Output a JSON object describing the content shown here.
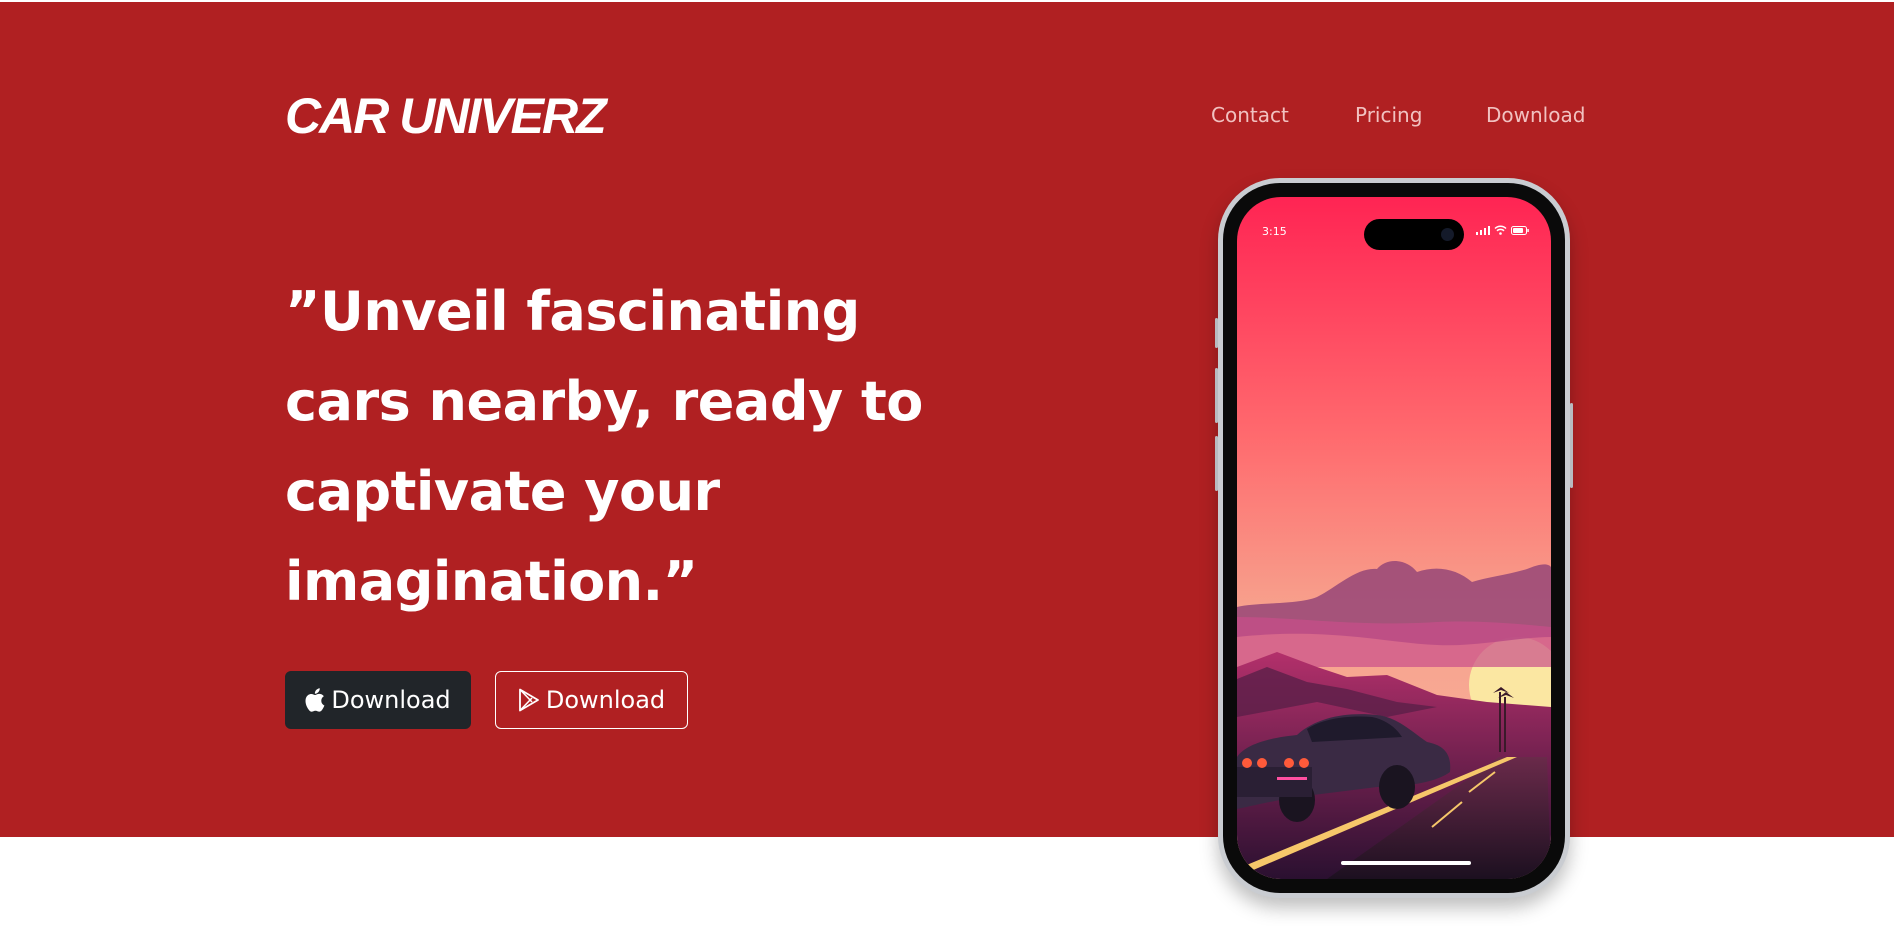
{
  "brand": {
    "name": "CAR UNIVERZ"
  },
  "nav": {
    "items": [
      "Contact",
      "Pricing",
      "Download"
    ]
  },
  "hero": {
    "headline": "”Unveil fascinating cars nearby, ready to captivate your imagination.”",
    "buttons": {
      "apple": {
        "label": "Download",
        "icon": "apple-icon"
      },
      "play": {
        "label": "Download",
        "icon": "play-store-icon"
      }
    }
  },
  "phone": {
    "time": "3:15",
    "status_icons": [
      "signal-icon",
      "wifi-icon",
      "battery-icon"
    ]
  },
  "colors": {
    "hero_bg": "#b02022",
    "apple_button_bg": "#212529",
    "nav_text": "#f1c1c0"
  }
}
